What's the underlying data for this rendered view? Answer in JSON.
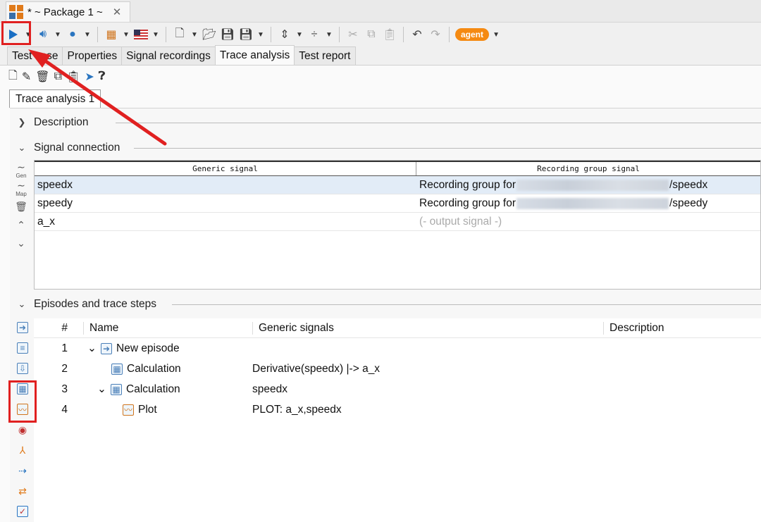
{
  "window": {
    "doc_tab": "* ~ Package 1 ~",
    "close_glyph": "✕"
  },
  "toolbar": {
    "agent_label": "agent"
  },
  "tabs": [
    "Test case",
    "Properties",
    "Signal recordings",
    "Trace analysis",
    "Test report"
  ],
  "inner_tab": "Trace analysis 1",
  "sections": {
    "description": "Description",
    "signal_connection": "Signal connection",
    "episodes": "Episodes and trace steps"
  },
  "signal_table": {
    "headers": [
      "Generic signal",
      "Recording group signal"
    ],
    "side_labels": {
      "gen": "Gen",
      "map": "Map"
    },
    "rows": [
      {
        "generic": "speedx",
        "prefix": "Recording group for",
        "suffix": "/speedx"
      },
      {
        "generic": "speedy",
        "prefix": "Recording group for",
        "suffix": "/speedy"
      },
      {
        "generic": "a_x",
        "prefix": "(- output signal -)",
        "suffix": ""
      }
    ]
  },
  "episodes_table": {
    "headers": {
      "num": "#",
      "name": "Name",
      "generic": "Generic signals",
      "description": "Description"
    },
    "rows": [
      {
        "num": "1",
        "name": "New episode",
        "generic": ""
      },
      {
        "num": "2",
        "name": "Calculation",
        "generic": "Derivative(speedx)  |-> a_x"
      },
      {
        "num": "3",
        "name": "Calculation",
        "generic": "speedx"
      },
      {
        "num": "4",
        "name": "Plot",
        "generic": "PLOT: a_x,speedx"
      }
    ]
  },
  "colors": {
    "highlight": "#e02020",
    "accent": "#f58a12",
    "selection": "#e2ecf7",
    "run": "#1a6fc4"
  }
}
